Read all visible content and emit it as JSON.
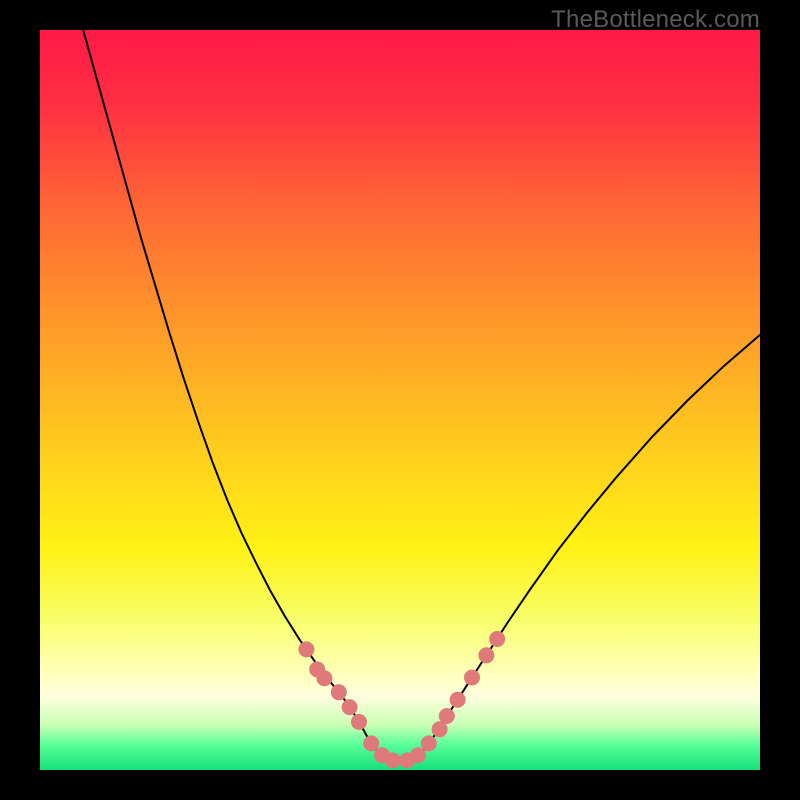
{
  "watermark": "TheBottleneck.com",
  "chart_data": {
    "type": "line",
    "title": "",
    "xlabel": "",
    "ylabel": "",
    "xlim": [
      0,
      100
    ],
    "ylim": [
      0,
      100
    ],
    "grid": false,
    "legend": false,
    "background_gradient_stops": [
      {
        "offset": 0.0,
        "color": "#ff1a47"
      },
      {
        "offset": 0.1,
        "color": "#ff2f42"
      },
      {
        "offset": 0.25,
        "color": "#ff6a34"
      },
      {
        "offset": 0.4,
        "color": "#ff9a2a"
      },
      {
        "offset": 0.55,
        "color": "#ffc81f"
      },
      {
        "offset": 0.7,
        "color": "#fff215"
      },
      {
        "offset": 0.8,
        "color": "#f8ff6e"
      },
      {
        "offset": 0.86,
        "color": "#ffffb0"
      },
      {
        "offset": 0.9,
        "color": "#ffffde"
      },
      {
        "offset": 0.94,
        "color": "#c7ffb4"
      },
      {
        "offset": 0.965,
        "color": "#5cff9a"
      },
      {
        "offset": 1.0,
        "color": "#14e07a"
      }
    ],
    "series": [
      {
        "name": "left-branch",
        "color": "#000000",
        "stroke_width": 2,
        "x": [
          6,
          8,
          10,
          12,
          14,
          16,
          18,
          20,
          22,
          24,
          26,
          28,
          30,
          32,
          34,
          36,
          38,
          40,
          41,
          42,
          43,
          44,
          45,
          46
        ],
        "y": [
          100,
          93,
          86,
          79,
          72,
          65.5,
          59,
          52.8,
          47,
          41.5,
          36.5,
          32,
          28,
          24.2,
          20.8,
          17.7,
          14.9,
          12.3,
          11.1,
          9.9,
          8.5,
          7.0,
          5.3,
          3.5
        ]
      },
      {
        "name": "valley-floor",
        "color": "#000000",
        "stroke_width": 2,
        "x": [
          46,
          47,
          48,
          49,
          50,
          51,
          52,
          53,
          54
        ],
        "y": [
          3.5,
          2.4,
          1.7,
          1.3,
          1.2,
          1.3,
          1.7,
          2.4,
          3.5
        ]
      },
      {
        "name": "right-branch",
        "color": "#000000",
        "stroke_width": 2,
        "x": [
          54,
          55,
          56,
          58,
          60,
          62,
          65,
          68,
          72,
          76,
          80,
          85,
          90,
          95,
          100
        ],
        "y": [
          3.5,
          5.0,
          6.5,
          9.5,
          12.5,
          15.5,
          20.0,
          24.3,
          29.8,
          34.8,
          39.5,
          45.0,
          50.0,
          54.6,
          58.8
        ]
      }
    ],
    "markers": {
      "name": "data-points",
      "color": "#e07a7a",
      "radius": 8,
      "points": [
        {
          "x": 37.0,
          "y": 16.3
        },
        {
          "x": 38.5,
          "y": 13.6
        },
        {
          "x": 39.5,
          "y": 12.4
        },
        {
          "x": 41.5,
          "y": 10.5
        },
        {
          "x": 43.0,
          "y": 8.5
        },
        {
          "x": 44.3,
          "y": 6.5
        },
        {
          "x": 46.0,
          "y": 3.6
        },
        {
          "x": 47.5,
          "y": 2.0
        },
        {
          "x": 49.0,
          "y": 1.3
        },
        {
          "x": 51.0,
          "y": 1.3
        },
        {
          "x": 52.5,
          "y": 2.0
        },
        {
          "x": 54.0,
          "y": 3.6
        },
        {
          "x": 55.5,
          "y": 5.5
        },
        {
          "x": 56.5,
          "y": 7.3
        },
        {
          "x": 58.0,
          "y": 9.5
        },
        {
          "x": 60.0,
          "y": 12.5
        },
        {
          "x": 62.0,
          "y": 15.5
        },
        {
          "x": 63.5,
          "y": 17.7
        }
      ]
    }
  }
}
